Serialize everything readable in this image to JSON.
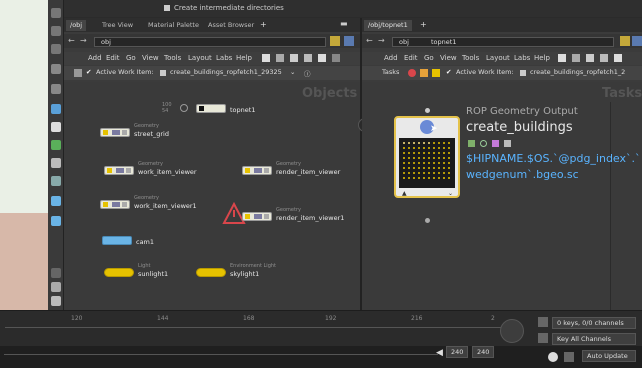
{
  "top_strip": {
    "option_label": "Create intermediate directories"
  },
  "left_pane": {
    "tabs": [
      "/obj",
      "Tree View",
      "Material Palette",
      "Asset Browser"
    ],
    "path": "obj",
    "menus": [
      "Add",
      "Edit",
      "Go",
      "View",
      "Tools",
      "Layout",
      "Labs",
      "Help"
    ],
    "task_items": [
      "Active Work Item:",
      "create_buildings_ropfetch1_29325"
    ],
    "context_label": "Objects",
    "nodes": [
      {
        "type": "",
        "name": "topnet1",
        "counts": "100\n54"
      },
      {
        "type": "Geometry",
        "name": "street_grid"
      },
      {
        "type": "Geometry",
        "name": "work_item_viewer"
      },
      {
        "type": "Geometry",
        "name": "render_item_viewer"
      },
      {
        "type": "Geometry",
        "name": "work_item_viewer1"
      },
      {
        "type": "Geometry",
        "name": "render_item_viewer1"
      },
      {
        "type": "",
        "name": "cam1"
      },
      {
        "type": "Light",
        "name": "sunlight1"
      },
      {
        "type": "Environment Light",
        "name": "skylight1"
      }
    ]
  },
  "right_pane": {
    "tabs": [
      "/obj/topnet1"
    ],
    "path_parts": [
      "obj",
      "topnet1"
    ],
    "menus": [
      "Add",
      "Edit",
      "Go",
      "View",
      "Tools",
      "Layout",
      "Labs",
      "Help"
    ],
    "task_label": "Tasks",
    "task_items": [
      "Active Work Item:",
      "create_buildings_ropfetch1_2"
    ],
    "context_label": "Tasks",
    "rop_node": {
      "type": "ROP Geometry Output",
      "name": "create_buildings",
      "output_line1": "$HIPNAME.$OS.`@pdg_index`.`",
      "output_line2": "wedgenum`.bgeo.sc"
    }
  },
  "timeline": {
    "ticks": [
      "120",
      "144",
      "168",
      "192",
      "216",
      "2"
    ],
    "keys_label": "0 keys, 0/0 channels",
    "key_all_channels": "Key All Channels",
    "frame_start": "240",
    "frame_end": "240",
    "auto_update": "Auto Update"
  }
}
